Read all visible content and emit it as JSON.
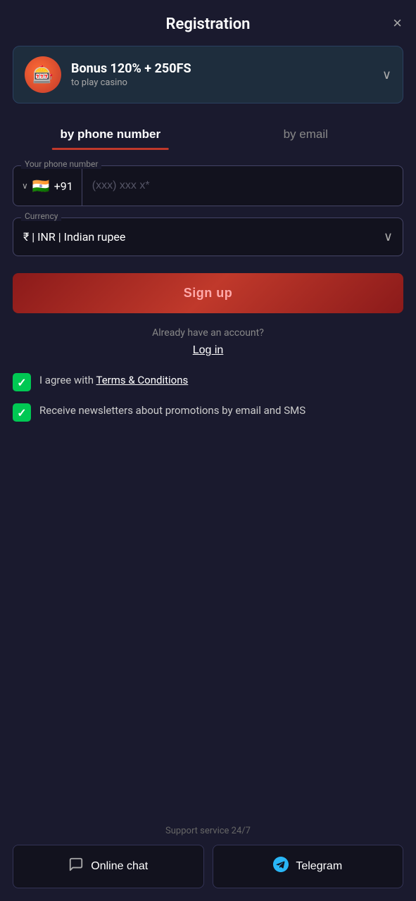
{
  "header": {
    "title": "Registration",
    "close_label": "×"
  },
  "bonus": {
    "title": "Bonus 120% + 250FS",
    "subtitle": "to play casino",
    "chevron": "∨"
  },
  "tabs": [
    {
      "id": "phone",
      "label": "by phone number",
      "active": true
    },
    {
      "id": "email",
      "label": "by email",
      "active": false
    }
  ],
  "phone_field": {
    "label": "Your phone number",
    "country_code": "+91",
    "placeholder": "(xxx) xxx x*"
  },
  "currency_field": {
    "label": "Currency",
    "value": "₹ | INR | Indian rupee"
  },
  "signup_button": {
    "label": "Sign up"
  },
  "login": {
    "already_text": "Already have an account?",
    "login_label": "Log in"
  },
  "checkboxes": [
    {
      "id": "terms",
      "checked": true,
      "label_before": "I agree with ",
      "link_text": "Terms & Conditions",
      "label_after": ""
    },
    {
      "id": "newsletters",
      "checked": true,
      "label_before": "Receive newsletters about promotions by email and SMS",
      "link_text": "",
      "label_after": ""
    }
  ],
  "support": {
    "label": "Support service 24/7",
    "buttons": [
      {
        "id": "chat",
        "label": "Online chat",
        "icon": "chat"
      },
      {
        "id": "telegram",
        "label": "Telegram",
        "icon": "telegram"
      }
    ]
  },
  "colors": {
    "accent_red": "#c0392b",
    "bg_dark": "#1a1a2e",
    "green_check": "#00c853"
  }
}
